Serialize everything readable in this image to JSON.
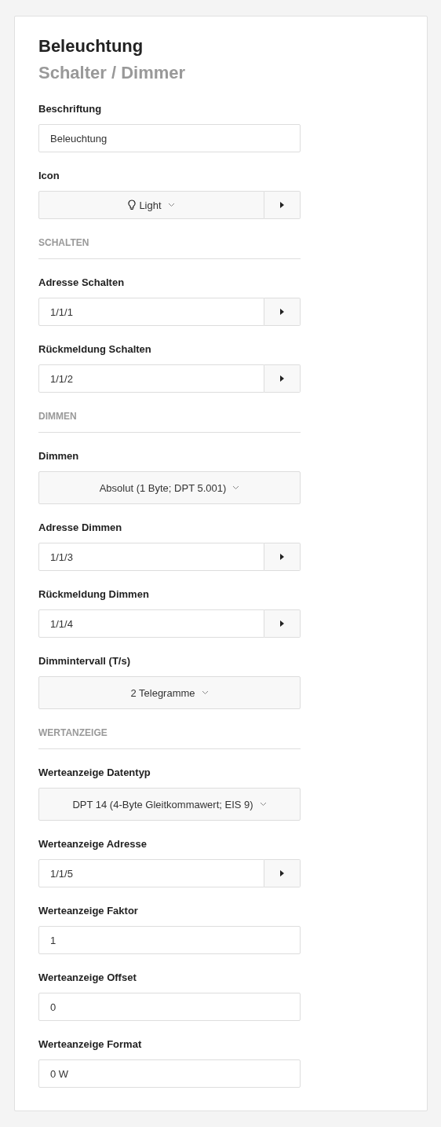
{
  "title": "Beleuchtung",
  "subtitle": "Schalter / Dimmer",
  "fields": [
    {
      "kind": "text",
      "label": "Beschriftung",
      "value": "Beleuchtung"
    },
    {
      "kind": "icon_select",
      "label": "Icon",
      "value": "Light"
    },
    {
      "kind": "section",
      "label": "SCHALTEN"
    },
    {
      "kind": "address",
      "label": "Adresse Schalten",
      "value": "1/1/1"
    },
    {
      "kind": "address",
      "label": "Rückmeldung Schalten",
      "value": "1/1/2"
    },
    {
      "kind": "section",
      "label": "DIMMEN"
    },
    {
      "kind": "select",
      "label": "Dimmen",
      "value": "Absolut (1 Byte; DPT 5.001)"
    },
    {
      "kind": "address",
      "label": "Adresse Dimmen",
      "value": "1/1/3"
    },
    {
      "kind": "address",
      "label": "Rückmeldung Dimmen",
      "value": "1/1/4"
    },
    {
      "kind": "select",
      "label": "Dimmintervall (T/s)",
      "value": "2 Telegramme"
    },
    {
      "kind": "section",
      "label": "WERTANZEIGE"
    },
    {
      "kind": "select",
      "label": "Werteanzeige Datentyp",
      "value": "DPT 14 (4-Byte Gleitkommawert; EIS 9)"
    },
    {
      "kind": "address",
      "label": "Werteanzeige Adresse",
      "value": "1/1/5"
    },
    {
      "kind": "text",
      "label": "Werteanzeige Faktor",
      "value": "1"
    },
    {
      "kind": "text",
      "label": "Werteanzeige Offset",
      "value": "0"
    },
    {
      "kind": "text",
      "label": "Werteanzeige Format",
      "value": "0 W"
    }
  ]
}
